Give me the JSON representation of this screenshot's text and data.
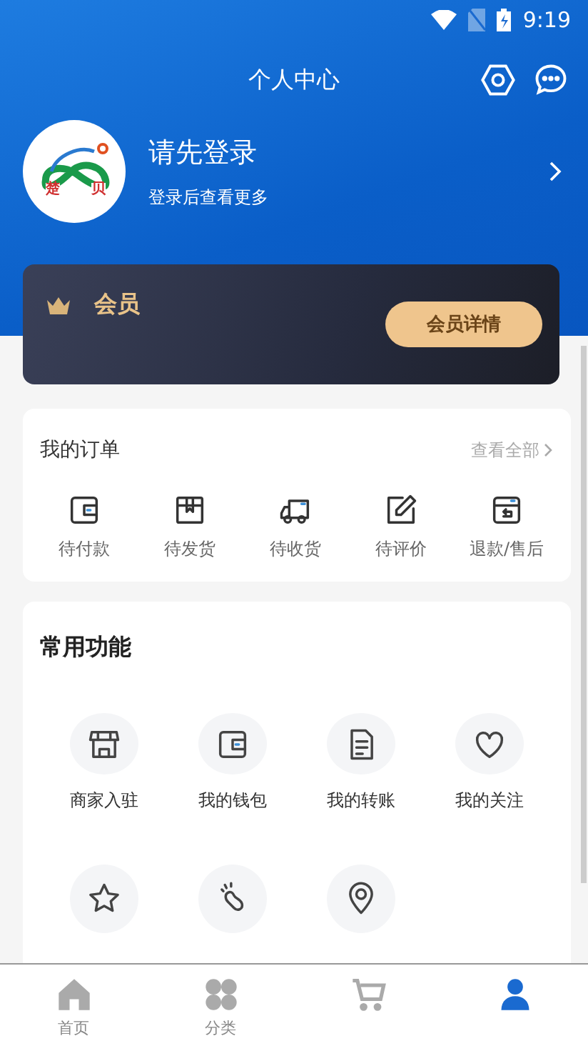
{
  "status_bar": {
    "time": "9:19"
  },
  "header": {
    "title": "个人中心"
  },
  "profile": {
    "name": "请先登录",
    "subtitle": "登录后查看更多",
    "logo_texts": [
      "楚",
      "贝"
    ]
  },
  "member": {
    "title": "会员",
    "button": "会员详情"
  },
  "orders": {
    "title": "我的订单",
    "view_all": "查看全部",
    "items": [
      {
        "label": "待付款",
        "kind": "wallet"
      },
      {
        "label": "待发货",
        "kind": "box"
      },
      {
        "label": "待收货",
        "kind": "truck"
      },
      {
        "label": "待评价",
        "kind": "edit"
      },
      {
        "label": "退款/售后",
        "kind": "refund"
      }
    ]
  },
  "features": {
    "title": "常用功能",
    "items": [
      {
        "label": "商家入驻",
        "kind": "store"
      },
      {
        "label": "我的钱包",
        "kind": "wallet"
      },
      {
        "label": "我的转账",
        "kind": "doc"
      },
      {
        "label": "我的关注",
        "kind": "heart"
      },
      {
        "kind": "star"
      },
      {
        "kind": "foot"
      },
      {
        "kind": "pin"
      }
    ]
  },
  "bottom_nav": [
    {
      "label": "首页",
      "kind": "home",
      "selected": false
    },
    {
      "label": "分类",
      "kind": "grid",
      "selected": false
    },
    {
      "kind": "cart",
      "selected": false
    },
    {
      "kind": "user",
      "selected": true
    }
  ]
}
